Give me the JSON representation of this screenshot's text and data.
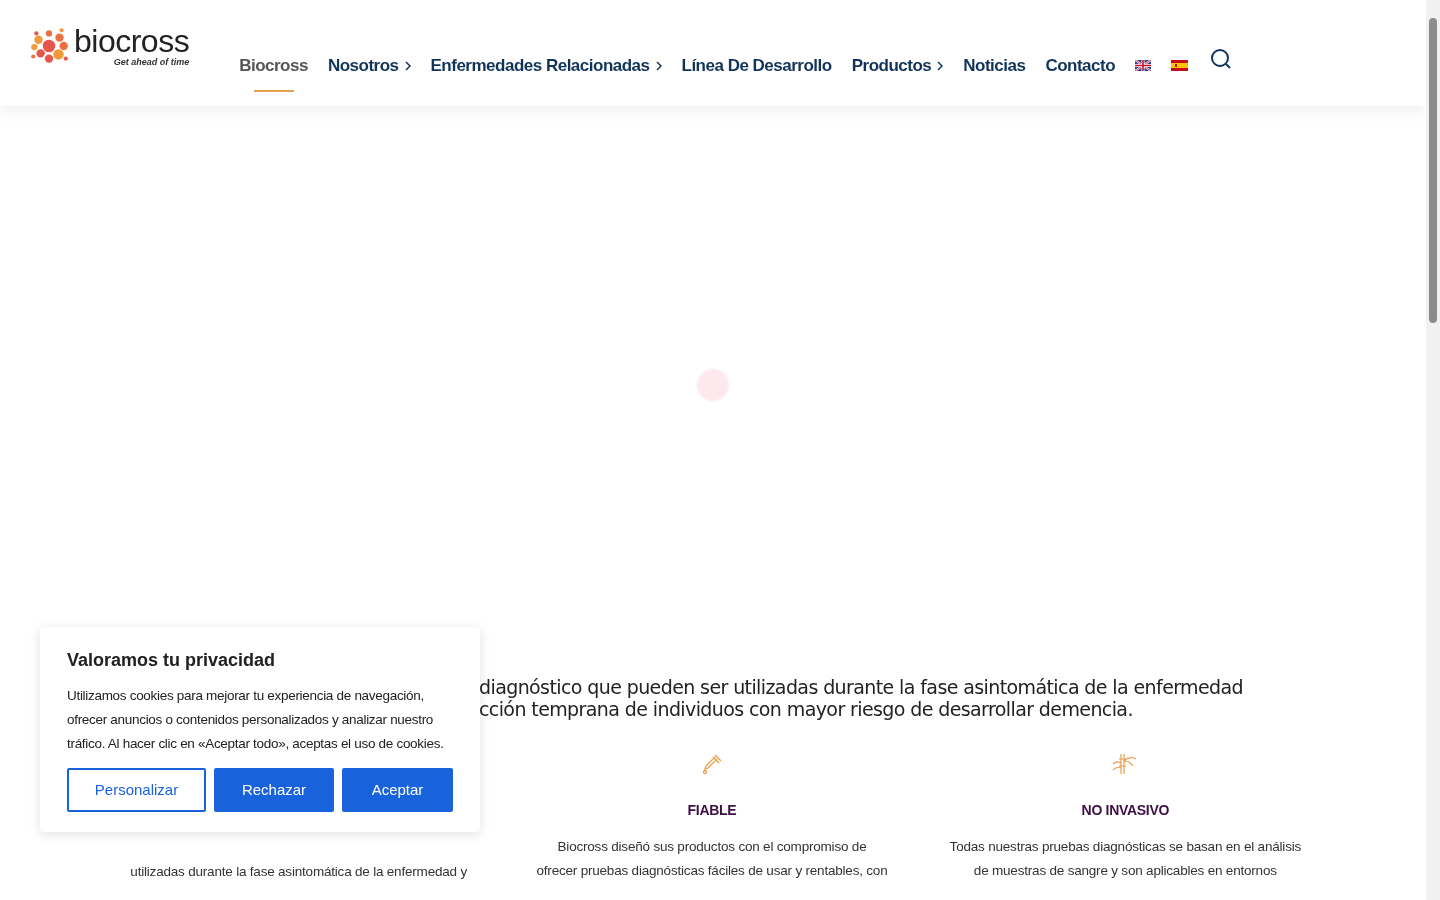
{
  "logo": {
    "name": "biocross",
    "tagline": "Get ahead of time"
  },
  "nav": [
    {
      "label": "Biocross",
      "selected": true,
      "has_submenu": false
    },
    {
      "label": "Nosotros",
      "selected": false,
      "has_submenu": true
    },
    {
      "label": "Enfermedades Relacionadas",
      "selected": false,
      "has_submenu": true
    },
    {
      "label": "Línea De Desarrollo",
      "selected": false,
      "has_submenu": false
    },
    {
      "label": "Productos",
      "selected": false,
      "has_submenu": true
    },
    {
      "label": "Noticias",
      "selected": false,
      "has_submenu": false
    },
    {
      "label": "Contacto",
      "selected": false,
      "has_submenu": false
    }
  ],
  "languages": [
    {
      "kind": "uk"
    },
    {
      "kind": "es"
    }
  ],
  "intro_lines": [
    "diagnóstico que pueden ser utilizadas durante la fase asintomática de la enfermedad",
    "cción temprana de individuos con mayor riesgo de desarrollar demencia."
  ],
  "features": [
    {
      "kind": "covered",
      "lines": [
        "utilizadas durante la fase asintomática de la enfermedad y"
      ]
    },
    {
      "kind": "dropper",
      "title": "FIABLE",
      "lines": [
        "Biocross diseñó sus productos con el compromiso de",
        "ofrecer pruebas diagnósticas fáciles de usar y rentables, con"
      ]
    },
    {
      "kind": "bamboo",
      "title": "NO INVASIVO",
      "lines": [
        "Todas nuestras pruebas diagnósticas se basan en el análisis",
        "de muestras de sangre y son aplicables en entornos"
      ]
    }
  ],
  "cookie": {
    "title": "Valoramos tu privacidad",
    "text": "Utilizamos cookies para mejorar tu experiencia de navegación, ofrecer anuncios o contenidos personalizados y analizar nuestro tráfico. Al hacer clic en «Aceptar todo», aceptas el uso de cookies.",
    "buttons": [
      {
        "label": "Personalizar",
        "kind": "outline"
      },
      {
        "label": "Rechazar",
        "kind": "solid"
      },
      {
        "label": "Aceptar",
        "kind": "solid"
      }
    ]
  }
}
